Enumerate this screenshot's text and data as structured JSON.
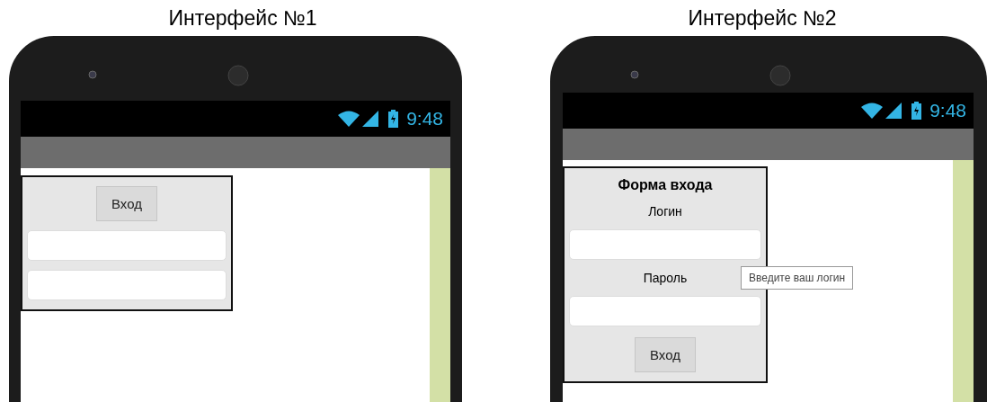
{
  "panels": [
    {
      "caption": "Интерфейс №1",
      "time": "9:48",
      "form": [
        {
          "kind": "button",
          "label": "Вход"
        },
        {
          "kind": "field"
        },
        {
          "kind": "field"
        }
      ]
    },
    {
      "caption": "Интерфейс №2",
      "time": "9:48",
      "form": [
        {
          "kind": "title",
          "label": "Форма входа"
        },
        {
          "kind": "label",
          "label": "Логин"
        },
        {
          "kind": "field"
        },
        {
          "kind": "label",
          "label": "Пароль"
        },
        {
          "kind": "field"
        },
        {
          "kind": "button",
          "label": "Вход"
        }
      ],
      "tooltip": "Введите ваш логин"
    }
  ]
}
